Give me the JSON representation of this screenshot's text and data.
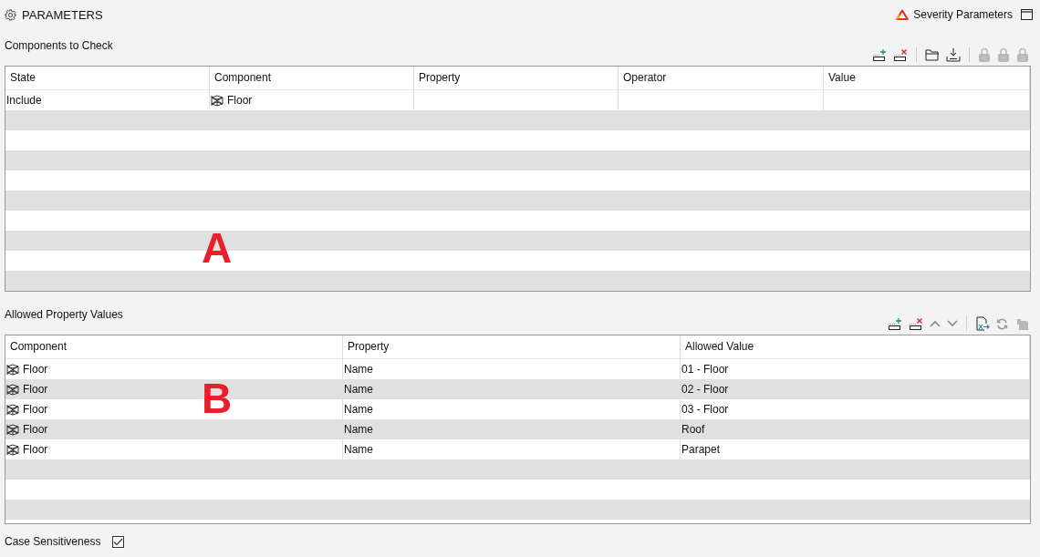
{
  "header": {
    "title": "PARAMETERS",
    "severity_link": "Severity Parameters"
  },
  "components_section": {
    "title": "Components to Check",
    "toolbar": [
      {
        "kind": "add-row",
        "disabled": false
      },
      {
        "kind": "delete-row",
        "disabled": false
      },
      {
        "kind": "separator"
      },
      {
        "kind": "open",
        "disabled": false
      },
      {
        "kind": "import",
        "disabled": false
      },
      {
        "kind": "separator"
      },
      {
        "kind": "lock-add",
        "disabled": true
      },
      {
        "kind": "lock-remove",
        "disabled": true
      },
      {
        "kind": "lock-list",
        "disabled": true
      }
    ],
    "columns": [
      "State",
      "Component",
      "Property",
      "Operator",
      "Value"
    ],
    "rows": [
      {
        "cells": [
          "Include",
          "Floor",
          "",
          "",
          ""
        ]
      }
    ],
    "annotation": "A"
  },
  "allowed_section": {
    "title": "Allowed Property Values",
    "toolbar": [
      {
        "kind": "add-row",
        "disabled": false
      },
      {
        "kind": "delete-row",
        "disabled": false
      },
      {
        "kind": "up",
        "disabled": false
      },
      {
        "kind": "down",
        "disabled": false
      },
      {
        "kind": "separator"
      },
      {
        "kind": "export",
        "disabled": false
      },
      {
        "kind": "refresh",
        "disabled": false
      },
      {
        "kind": "stamp",
        "disabled": true
      }
    ],
    "columns": [
      "Component",
      "Property",
      "Allowed Value"
    ],
    "rows": [
      {
        "cells": [
          "Floor",
          "Name",
          "01 - Floor"
        ]
      },
      {
        "cells": [
          "Floor",
          "Name",
          "02 - Floor"
        ]
      },
      {
        "cells": [
          "Floor",
          "Name",
          "03 - Floor"
        ]
      },
      {
        "cells": [
          "Floor",
          "Name",
          "Roof"
        ]
      },
      {
        "cells": [
          "Floor",
          "Name",
          "Parapet"
        ]
      }
    ],
    "annotation": "B"
  },
  "case_sensitiveness": {
    "label": "Case Sensitiveness",
    "checked": true
  }
}
